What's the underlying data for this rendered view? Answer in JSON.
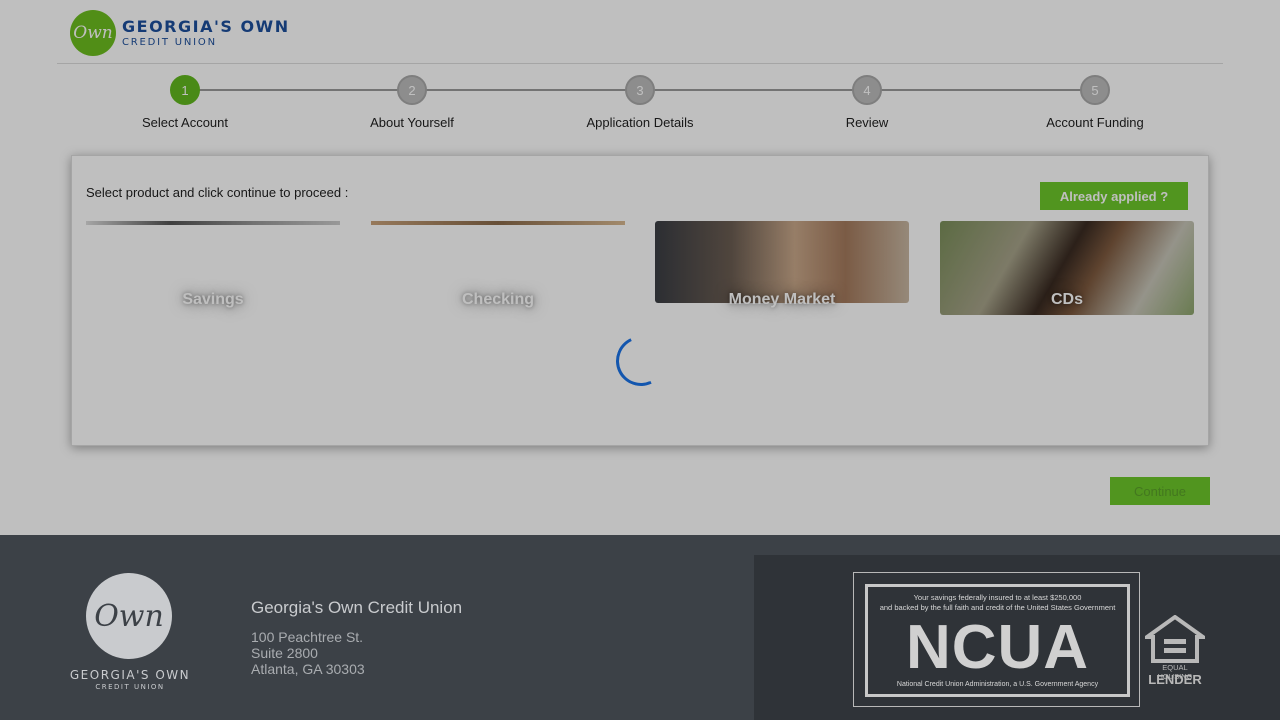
{
  "header": {
    "logo_mark": "Own",
    "logo_line1": "GEORGIA'S OWN",
    "logo_line2": "CREDIT UNION"
  },
  "stepper": {
    "steps": [
      {
        "number": "1",
        "label": "Select Account",
        "active": true
      },
      {
        "number": "2",
        "label": "About Yourself",
        "active": false
      },
      {
        "number": "3",
        "label": "Application Details",
        "active": false
      },
      {
        "number": "4",
        "label": "Review",
        "active": false
      },
      {
        "number": "5",
        "label": "Account Funding",
        "active": false
      }
    ]
  },
  "panel": {
    "instruction": "Select product and click continue to proceed :",
    "already_applied_label": "Already applied ?",
    "products": [
      {
        "label": "Savings"
      },
      {
        "label": "Checking"
      },
      {
        "label": "Money Market"
      },
      {
        "label": "CDs"
      }
    ]
  },
  "continue_label": "Continue",
  "footer": {
    "logo_mark": "Own",
    "logo_line1": "GEORGIA'S OWN",
    "logo_line2": "CREDIT UNION",
    "org_name": "Georgia's Own Credit Union",
    "address": [
      "100 Peachtree St.",
      "Suite 2800",
      "Atlanta, GA 30303"
    ],
    "ncua": {
      "top_line1": "Your savings federally insured to at least $250,000",
      "top_line2": "and backed by the full faith and credit of the United States Government",
      "big": "NCUA",
      "bottom": "National Credit Union Administration, a U.S. Government Agency"
    },
    "ehl": {
      "line1": "EQUAL HOUSING",
      "line2": "LENDER"
    }
  },
  "colors": {
    "brand_green": "#6cc72a",
    "brand_blue": "#1d4f9c",
    "spinner": "#1a73e8",
    "footer_bg": "#3c4147"
  }
}
